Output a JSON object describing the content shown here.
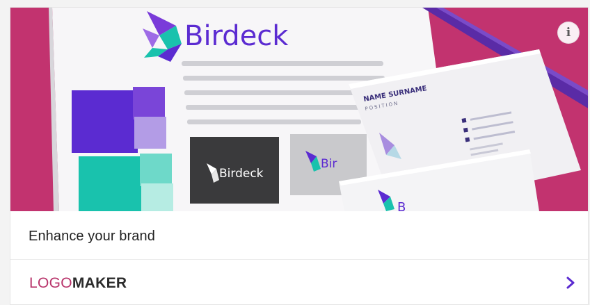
{
  "hero": {
    "brand_name": "Birdeck",
    "card_name": "NAME SURNAME",
    "card_position": "POSITION",
    "small_logo_text_dark": "Birdeck",
    "small_logo_text_light": "Bir",
    "small_logo_text_card": "B",
    "info_icon": "info-icon"
  },
  "caption": "Enhance your brand",
  "footer": {
    "logo_part": "LOGO",
    "maker_part": "MAKER",
    "chevron_icon": "chevron-right-icon"
  },
  "colors": {
    "magenta_bg": "#c2336f",
    "brand_purple": "#5b2bd1",
    "brand_teal": "#19c2ad",
    "logo_pink": "#b8336a"
  }
}
